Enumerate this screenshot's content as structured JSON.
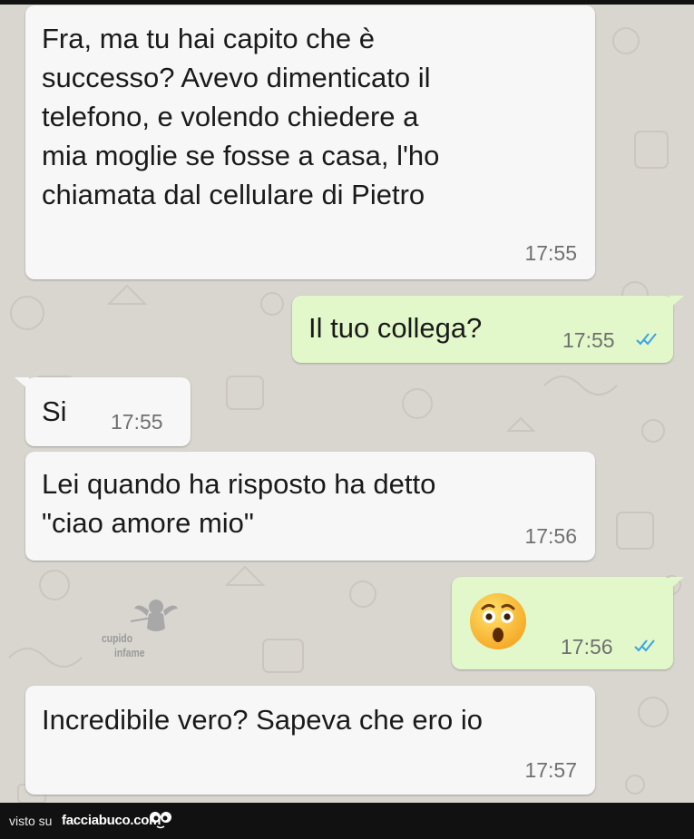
{
  "chat": {
    "messages": [
      {
        "direction": "incoming",
        "lines": [
          "Fra, ma tu hai capito che è",
          "successo? Avevo dimenticato il",
          "telefono, e volendo chiedere a",
          "mia moglie se fosse a casa, l'ho",
          "chiamata dal cellulare di Pietro"
        ],
        "time": "17:55"
      },
      {
        "direction": "outgoing",
        "text": "Il tuo collega?",
        "time": "17:55",
        "read": true
      },
      {
        "direction": "incoming",
        "text": "Si",
        "time": "17:55"
      },
      {
        "direction": "incoming",
        "lines": [
          "Lei quando ha risposto ha detto",
          "\"ciao amore mio\""
        ],
        "time": "17:56"
      },
      {
        "direction": "outgoing",
        "emoji": "astonished-face",
        "time": "17:56",
        "read": true
      },
      {
        "direction": "incoming",
        "text": "Incredibile vero? Sapeva che ero io",
        "time": "17:57"
      }
    ]
  },
  "watermark": {
    "line1": "cupido",
    "line2": "infame",
    "icon": "cupid-icon"
  },
  "footer": {
    "visto_label": "visto su",
    "site": "facciabuco.com",
    "logo_icon": "eyes-logo-icon"
  },
  "colors": {
    "incoming_bubble": "#f7f7f7",
    "outgoing_bubble": "#e2f8ca",
    "read_ticks": "#3aa3e3",
    "background": "#d9d6d0",
    "footer": "#111111"
  }
}
